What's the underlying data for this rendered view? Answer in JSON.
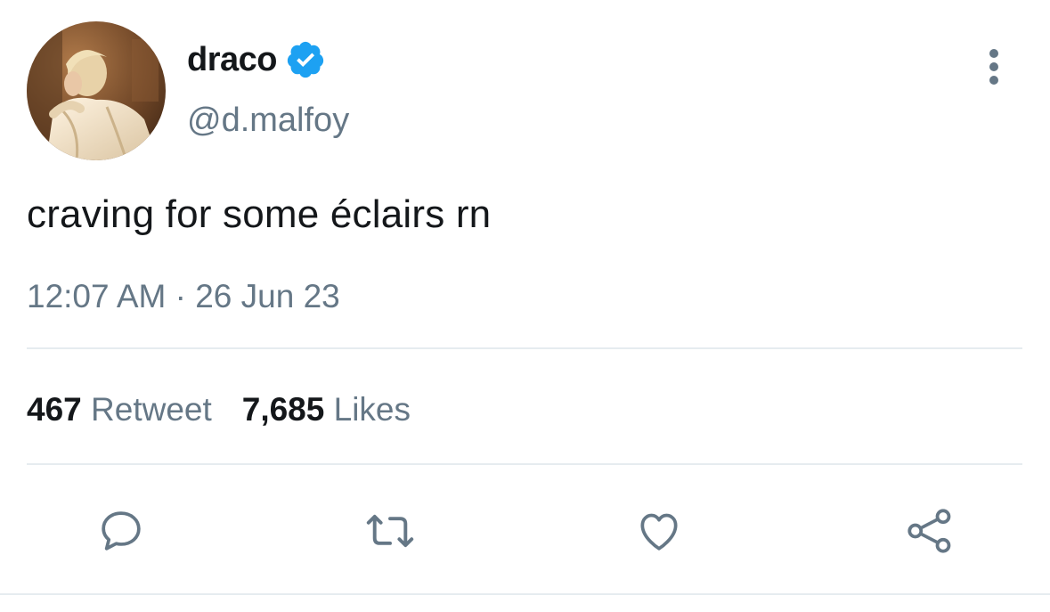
{
  "tweet": {
    "author": {
      "display_name": "draco",
      "handle": "@d.malfoy",
      "verified": true,
      "verified_icon": "verified-badge-icon",
      "avatar": "profile-photo"
    },
    "text": "craving for some éclairs rn",
    "time": "12:07 AM",
    "separator": "·",
    "date": "26 Jun 23",
    "stats": {
      "retweets_count": "467",
      "retweets_label": "Retweet",
      "likes_count": "7,685",
      "likes_label": "Likes"
    },
    "actions": [
      {
        "name": "reply",
        "icon": "comment-icon"
      },
      {
        "name": "retweet",
        "icon": "retweet-icon"
      },
      {
        "name": "like",
        "icon": "heart-icon"
      },
      {
        "name": "share",
        "icon": "share-icon"
      }
    ]
  },
  "colors": {
    "primary_text": "#14171a",
    "secondary_text": "#657786",
    "verified_blue": "#1da1f2",
    "divider": "#e6ecf0",
    "icon": "#657786"
  }
}
